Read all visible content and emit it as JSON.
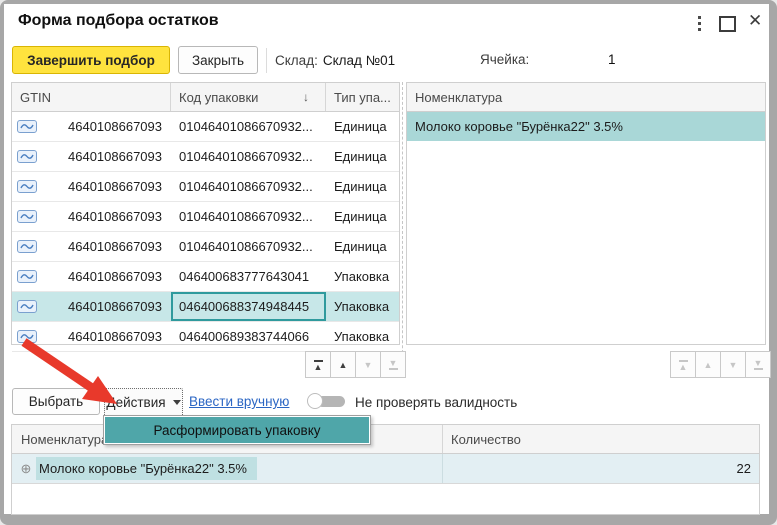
{
  "window": {
    "title": "Форма подбора остатков",
    "close_glyph": "✕"
  },
  "toolbar": {
    "finish_label": "Завершить подбор",
    "close_label": "Закрыть",
    "warehouse_label": "Склад:",
    "warehouse_value": "Склад №01",
    "cell_label": "Ячейка:",
    "cell_value": "1"
  },
  "left_table": {
    "columns": [
      "GTIN",
      "Код упаковки",
      "Тип упа..."
    ],
    "sort_glyph": "↓",
    "row_icon": "barcode-mark-icon",
    "rows": [
      {
        "gtin": "4640108667093",
        "code": "01046401086670932...",
        "type": "Единица",
        "selected": false
      },
      {
        "gtin": "4640108667093",
        "code": "01046401086670932...",
        "type": "Единица",
        "selected": false
      },
      {
        "gtin": "4640108667093",
        "code": "01046401086670932...",
        "type": "Единица",
        "selected": false
      },
      {
        "gtin": "4640108667093",
        "code": "01046401086670932...",
        "type": "Единица",
        "selected": false
      },
      {
        "gtin": "4640108667093",
        "code": "01046401086670932...",
        "type": "Единица",
        "selected": false
      },
      {
        "gtin": "4640108667093",
        "code": "046400683777643041",
        "type": "Упаковка",
        "selected": false
      },
      {
        "gtin": "4640108667093",
        "code": "046400688374948445",
        "type": "Упаковка",
        "selected": true
      },
      {
        "gtin": "4640108667093",
        "code": "046400689383744066",
        "type": "Упаковка",
        "selected": false
      }
    ],
    "nav": {
      "top": "▲",
      "up": "▲",
      "down": "▼",
      "bottom": "▼"
    }
  },
  "right_panel": {
    "header": "Номенклатура",
    "selected_row": "Молоко коровье \"Бурёнка22\" 3.5%",
    "nav": {
      "top": "▲",
      "up": "▲",
      "down": "▼",
      "bottom": "▼"
    }
  },
  "actions_row": {
    "select_label": "Выбрать",
    "actions_label": "Действия",
    "manual_link": "Ввести вручную",
    "toggle_label": "Не проверять валидность",
    "toggle_state": "off"
  },
  "menu": {
    "items": [
      {
        "label": "Расформировать упаковку",
        "highlighted": true
      }
    ]
  },
  "bottom_table": {
    "columns": [
      "Номенклатура",
      "Количество"
    ],
    "rows": [
      {
        "expander": "⊕",
        "name": "Молоко коровье \"Бурёнка22\" 3.5%",
        "qty": "22"
      }
    ]
  },
  "colors": {
    "accent_yellow": "#ffe33e",
    "menu_teal": "#4fa6a9",
    "selection_teal": "#c7e7e8",
    "right_selection_teal": "#a9d7d7",
    "selected_cell_border": "#2f9a9d",
    "link_blue": "#2b66c4",
    "annotation_arrow_red": "#e8392b"
  }
}
